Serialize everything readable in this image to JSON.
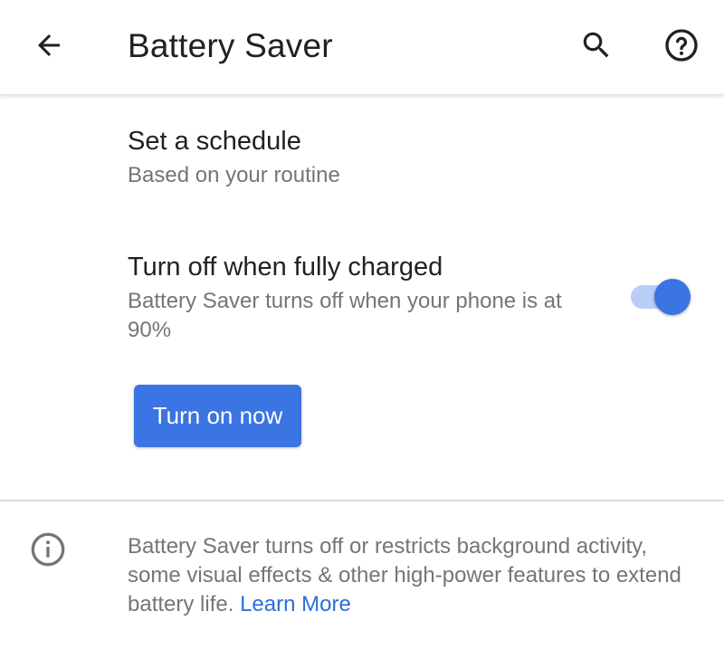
{
  "appbar": {
    "title": "Battery Saver",
    "back_icon": "arrow-back-icon",
    "search_icon": "search-icon",
    "help_icon": "help-circle-icon"
  },
  "settings": {
    "schedule": {
      "title": "Set a schedule",
      "subtitle": "Based on your routine"
    },
    "fully_charged": {
      "title": "Turn off when fully charged",
      "subtitle": "Battery Saver turns off when your phone is at 90%",
      "toggle_on": true
    },
    "turn_on_button": "Turn on now"
  },
  "footer": {
    "info_icon": "info-icon",
    "text": "Battery Saver turns off or restricts background activity, some visual effects & other high-power features to extend battery life. ",
    "link": "Learn More"
  },
  "colors": {
    "accent": "#3b74e3",
    "toggle_track": "#b9cdf6",
    "link": "#2a6fd6",
    "primary_text": "#202124",
    "secondary_text": "#757575"
  }
}
